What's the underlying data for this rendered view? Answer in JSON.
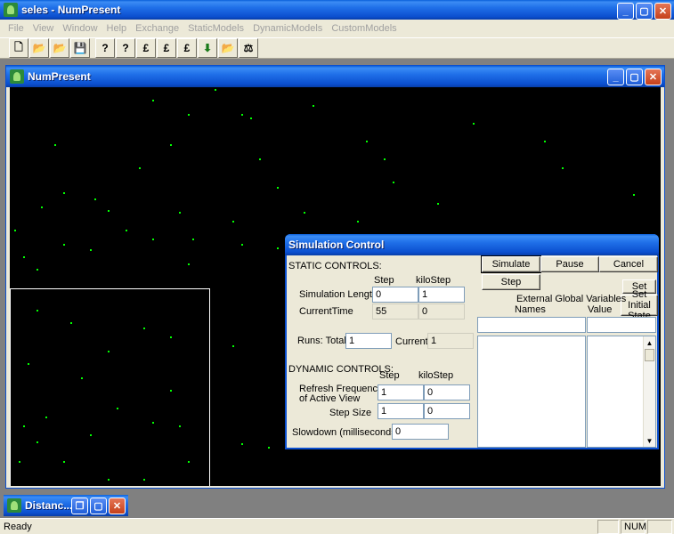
{
  "app": {
    "title": "seles - NumPresent"
  },
  "menu": [
    "File",
    "View",
    "Window",
    "Help",
    "Exchange",
    "StaticModels",
    "DynamicModels",
    "CustomModels"
  ],
  "toolbar": {
    "icons": [
      "new-file-icon",
      "open-folder-icon",
      "open-folder-icon",
      "save-icon",
      "help-icon",
      "context-help-icon",
      "landscape-icon",
      "landscape-event-icon",
      "landscape-stats-icon",
      "download-arrow-icon",
      "open-file-icon",
      "simulation-icon"
    ],
    "glyphs": [
      "🗋",
      "📂",
      "📂",
      "💾",
      "?",
      "?",
      "£",
      "£",
      "£",
      "⬇",
      "📂",
      "⚖"
    ]
  },
  "child_window": {
    "title": "NumPresent"
  },
  "minimized_window": {
    "title": "Distanc..."
  },
  "simulation_control": {
    "title": "Simulation Control",
    "static_header": "STATIC CONTROLS:",
    "col_step": "Step",
    "col_kilostep": "kiloStep",
    "sim_length_label": "Simulation Length",
    "sim_length_step": "0",
    "sim_length_kilo": "1",
    "current_time_label": "CurrentTime",
    "current_time_step": "55",
    "current_time_kilo": "0",
    "runs_total_label": "Runs: Total",
    "runs_total": "1",
    "current_label": "Current",
    "current": "1",
    "dynamic_header": "DYNAMIC CONTROLS:",
    "refresh_label_line1": "Refresh Frequency",
    "refresh_label_line2": "of Active View",
    "refresh_step": "1",
    "refresh_kilo": "0",
    "step_size_label": "Step Size",
    "step_size_step": "1",
    "step_size_kilo": "0",
    "slowdown_label": "Slowdown (milliseconds):",
    "slowdown": "0",
    "buttons": {
      "simulate": "Simulate",
      "pause": "Pause",
      "cancel": "Cancel",
      "step": "Step",
      "set": "Set",
      "set_initial_line1": "Set Initial",
      "set_initial_line2": "State"
    },
    "external_vars_title": "External Global Variables",
    "names_label": "Names",
    "value_label": "Value",
    "names_input": "",
    "value_input": ""
  },
  "status": {
    "text": "Ready",
    "num": "NUM"
  }
}
